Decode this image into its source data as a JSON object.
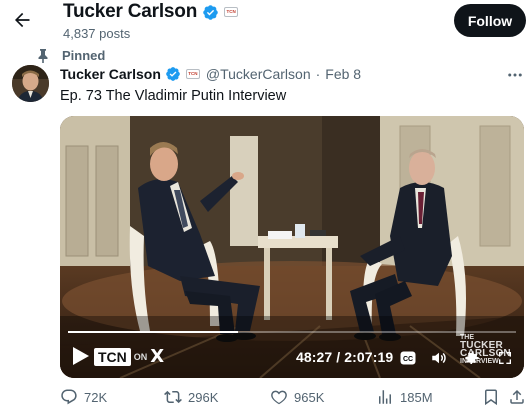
{
  "header": {
    "name": "Tucker Carlson",
    "posts_count": "4,837 posts",
    "follow_label": "Follow"
  },
  "pinned": {
    "label": "Pinned"
  },
  "post": {
    "author_name": "Tucker Carlson",
    "handle": "@TuckerCarlson",
    "separator": "·",
    "date": "Feb 8",
    "text": "Ep. 73  The Vladimir Putin Interview"
  },
  "video": {
    "time_label": "48:27 / 2:07:19",
    "progress": 0.38,
    "logo_text": "TCN",
    "logo_on": "ON",
    "logo_x": "X",
    "watermark_line1": "THE",
    "watermark_line2": "TUCKER",
    "watermark_line3": "CARLSON",
    "watermark_line4": "INTERVIEW"
  },
  "actions": {
    "replies": "72K",
    "reposts": "296K",
    "likes": "965K",
    "views": "185M"
  },
  "colors": {
    "verified_blue": "#1d9bf0",
    "follow_bg": "#0f1419",
    "secondary_text": "#536471"
  },
  "icons": {
    "back": "arrow-left-icon",
    "verified": "verified-badge-icon",
    "affiliate": "tcn-affiliate-badge-icon",
    "pin": "pin-icon",
    "more": "more-dots-icon",
    "play": "play-icon",
    "captions": "captions-icon",
    "volume": "volume-icon",
    "settings": "settings-icon",
    "fullscreen": "fullscreen-icon",
    "reply": "reply-icon",
    "repost": "repost-icon",
    "like": "heart-icon",
    "views": "views-icon",
    "bookmark": "bookmark-icon",
    "share": "share-icon"
  }
}
